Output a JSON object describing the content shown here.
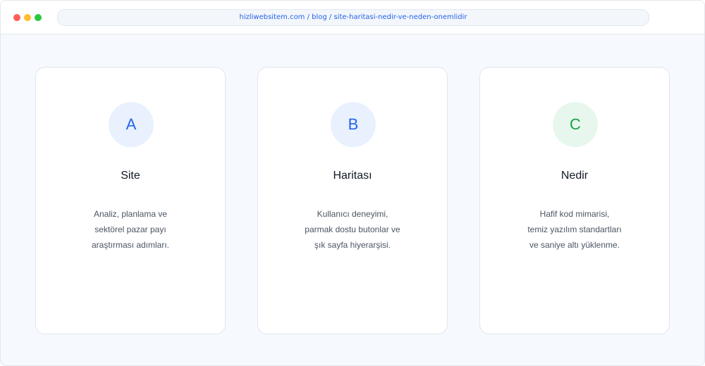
{
  "browser": {
    "url": "hizliwebsitem.com / blog / site-haritasi-nedir-ve-neden-onemlidir"
  },
  "cards": [
    {
      "letter": "A",
      "title": "Site",
      "lines": [
        "Analiz, planlama ve",
        "sektörel pazar payı",
        "araştırması adımları."
      ],
      "accent": "#2563eb",
      "badge_bg": "#e8f1fd"
    },
    {
      "letter": "B",
      "title": "Haritası",
      "lines": [
        "Kullanıcı deneyimi,",
        "parmak dostu butonlar ve",
        "şık sayfa hiyerarşisi."
      ],
      "accent": "#2563eb",
      "badge_bg": "#e8f1fd"
    },
    {
      "letter": "C",
      "title": "Nedir",
      "lines": [
        "Hafif kod mimarisi,",
        "temiz yazılım standartları",
        "ve saniye altı yüklenme."
      ],
      "accent": "#16a34a",
      "badge_bg": "#e8f7ee"
    }
  ]
}
